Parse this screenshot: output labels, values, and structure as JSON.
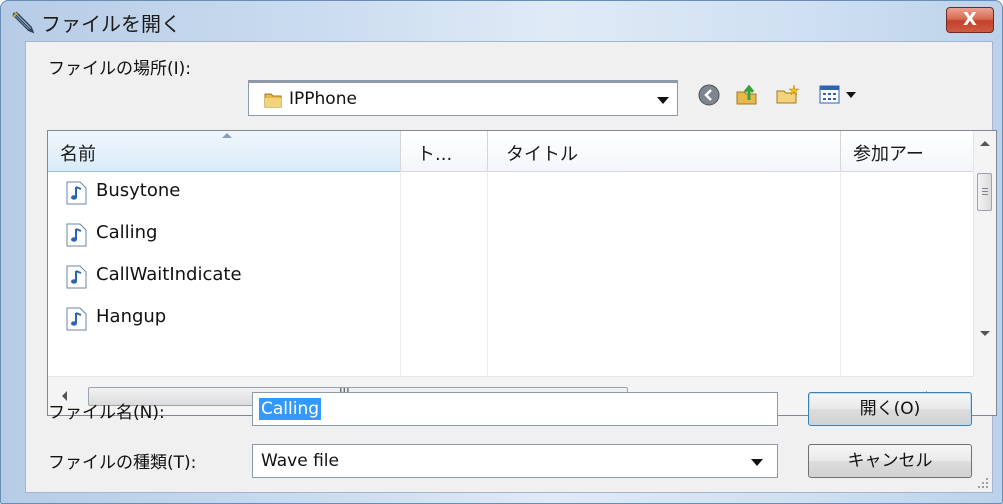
{
  "dialog": {
    "title": "ファイルを開く",
    "close_label": "X"
  },
  "location": {
    "label": "ファイルの場所(I):",
    "value": "IPPhone"
  },
  "columns": [
    {
      "label": "名前"
    },
    {
      "label": "ト..."
    },
    {
      "label": "タイトル"
    },
    {
      "label": "参加アー"
    }
  ],
  "files": [
    {
      "name": "Busytone"
    },
    {
      "name": "Calling"
    },
    {
      "name": "CallWaitIndicate"
    },
    {
      "name": "Hangup"
    }
  ],
  "hscroll_grip": "III",
  "filename": {
    "label": "ファイル名(N):",
    "value": "Calling"
  },
  "filetype": {
    "label": "ファイルの種類(T):",
    "value": "Wave file"
  },
  "buttons": {
    "open": "開く(O)",
    "cancel": "キャンセル"
  },
  "colors": {
    "selection": "#3399ff",
    "close_button": "#c2412a",
    "header_sorted": "#d9ebf9"
  },
  "icons": [
    "app-pen-icon",
    "close-icon",
    "folder-icon",
    "back-icon",
    "up-folder-icon",
    "new-folder-icon",
    "view-menu-icon",
    "wave-file-icon"
  ]
}
